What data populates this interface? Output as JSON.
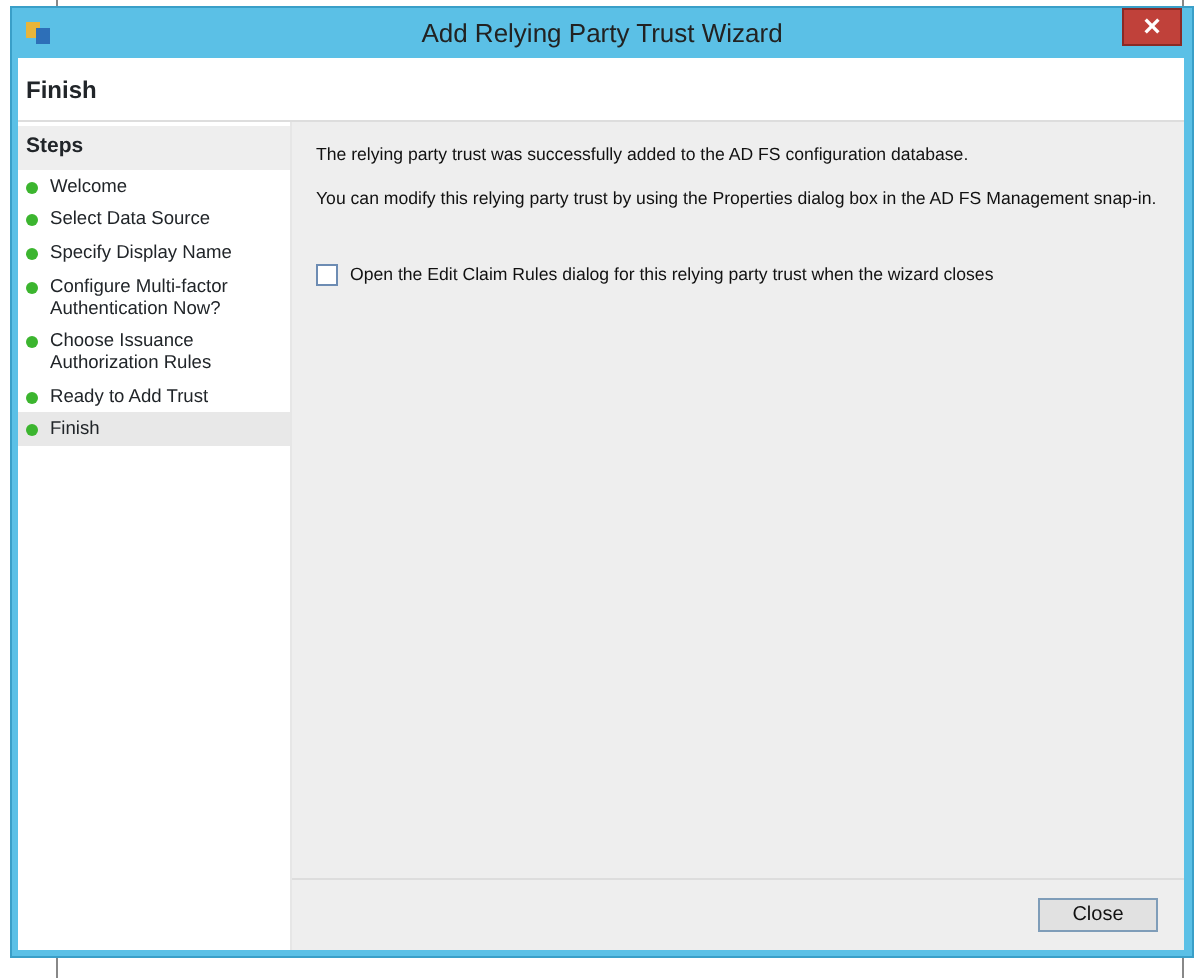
{
  "window": {
    "title": "Add Relying Party Trust Wizard",
    "close_glyph": "×"
  },
  "page_header": {
    "title": "Finish"
  },
  "steps": {
    "heading": "Steps",
    "items": [
      {
        "label": "Welcome",
        "selected": false
      },
      {
        "label": "Select Data Source",
        "selected": false
      },
      {
        "label": "Specify Display Name",
        "selected": false
      },
      {
        "label": "Configure Multi-factor Authentication Now?",
        "selected": false
      },
      {
        "label": "Choose Issuance Authorization Rules",
        "selected": false
      },
      {
        "label": "Ready to Add Trust",
        "selected": false
      },
      {
        "label": "Finish",
        "selected": true
      }
    ]
  },
  "content": {
    "messages": [
      "The relying party trust was successfully added to the AD FS configuration database.",
      "You can modify this relying party trust by using the Properties dialog box in the AD FS Management snap-in."
    ],
    "checkbox": {
      "label": "Open the Edit Claim Rules dialog for this relying party trust when the wizard closes",
      "checked": false
    }
  },
  "buttons": [
    {
      "label": "Close"
    }
  ]
}
